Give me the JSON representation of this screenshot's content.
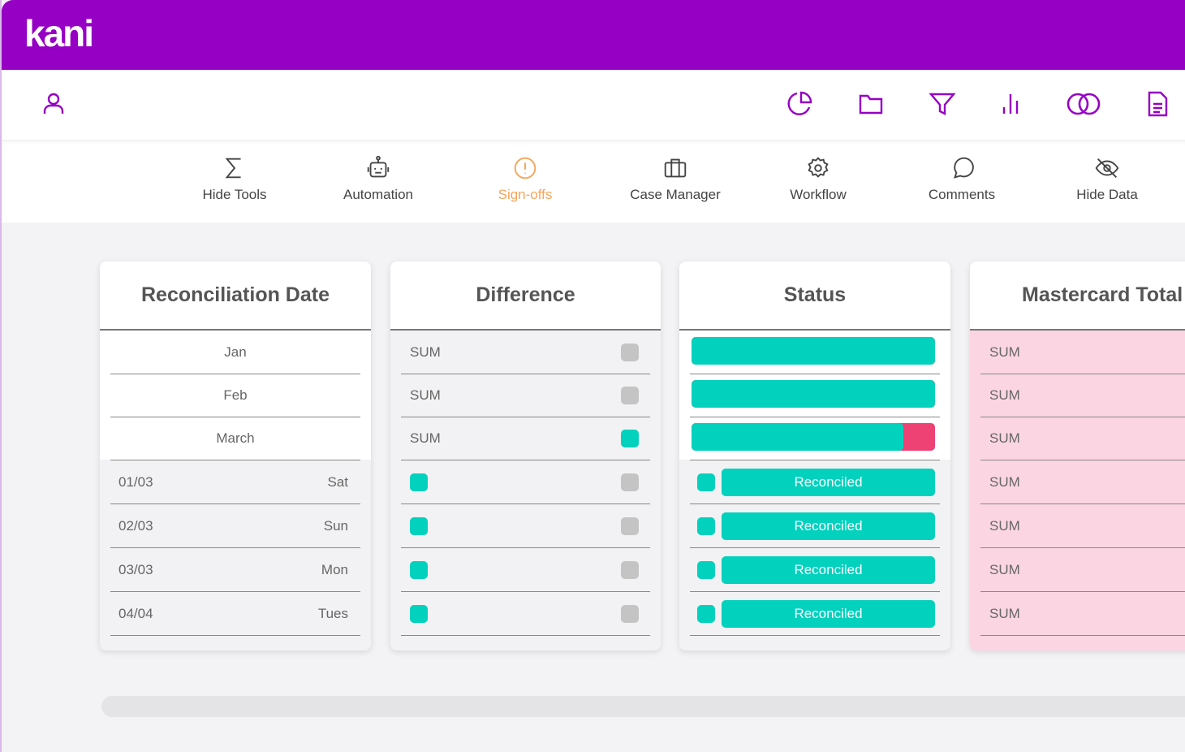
{
  "app": {
    "logo": "kani",
    "brand_color": "#9600c4",
    "accent_color": "#02d1bd",
    "alert_color": "#ee4174"
  },
  "iconbar": {
    "left": [
      "user-icon"
    ],
    "right": [
      "pie-chart-icon",
      "folder-icon",
      "filter-icon",
      "bar-chart-icon",
      "venn-icon",
      "document-icon"
    ]
  },
  "toolbar": [
    {
      "label": "Hide Tools",
      "icon": "sigma-icon"
    },
    {
      "label": "Automation",
      "icon": "robot-icon"
    },
    {
      "label": "Sign-offs",
      "icon": "alert-circle-icon",
      "active": true
    },
    {
      "label": "Case Manager",
      "icon": "briefcase-icon"
    },
    {
      "label": "Workflow",
      "icon": "gear-icon"
    },
    {
      "label": "Comments",
      "icon": "comment-icon"
    },
    {
      "label": "Hide Data",
      "icon": "eye-off-icon"
    }
  ],
  "columns": {
    "date": {
      "title": "Reconciliation Date",
      "months": [
        "Jan",
        "Feb",
        "March"
      ],
      "days": [
        {
          "date": "01/03",
          "day": "Sat"
        },
        {
          "date": "02/03",
          "day": "Sun"
        },
        {
          "date": "03/03",
          "day": "Mon"
        },
        {
          "date": "04/04",
          "day": "Tues"
        }
      ]
    },
    "difference": {
      "title": "Difference",
      "sums": [
        {
          "label": "SUM",
          "flag": "grey"
        },
        {
          "label": "SUM",
          "flag": "grey"
        },
        {
          "label": "SUM",
          "flag": "teal"
        }
      ],
      "days": [
        [
          "teal",
          "grey"
        ],
        [
          "teal",
          "grey"
        ],
        [
          "teal",
          "grey"
        ],
        [
          "teal",
          "grey"
        ]
      ]
    },
    "status": {
      "title": "Status",
      "progress": [
        100,
        100,
        87
      ],
      "rows": [
        "Reconciled",
        "Reconciled",
        "Reconciled",
        "Reconciled"
      ]
    },
    "mastercard": {
      "title": "Mastercard Total",
      "rows": [
        "SUM",
        "SUM",
        "SUM",
        "SUM",
        "SUM",
        "SUM",
        "SUM"
      ]
    }
  }
}
